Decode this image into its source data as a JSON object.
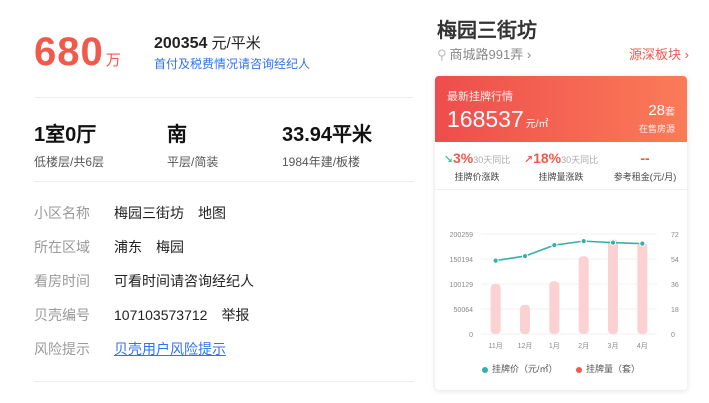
{
  "price": {
    "total": "680",
    "total_unit": "万",
    "unit_price": "200354",
    "unit_price_unit": " 元/平米",
    "tax_link": "首付及税费情况请咨询经纪人"
  },
  "house": {
    "layout": "1室0厅",
    "floor": "低楼层/共6层",
    "orientation": "南",
    "decoration": "平层/简装",
    "area": "33.94平米",
    "built": "1984年建/板楼"
  },
  "details": [
    {
      "label": "小区名称",
      "value": "梅园三街坊",
      "extra": "地图"
    },
    {
      "label": "所在区域",
      "value": "浦东",
      "extra": "梅园"
    },
    {
      "label": "看房时间",
      "value": "可看时间请咨询经纪人",
      "extra": ""
    },
    {
      "label": "贝壳编号",
      "value": "107103573712",
      "extra": "举报"
    },
    {
      "label": "风险提示",
      "value": "贝壳用户风险提示",
      "extra": ""
    }
  ],
  "community": {
    "name": "梅园三街坊",
    "address": "商城路991弄",
    "address_arrow": "›",
    "source_link": "源深板块 ›"
  },
  "market": {
    "label": "最新挂牌行情",
    "price": "168537",
    "price_unit": "元/㎡",
    "count": "28",
    "count_unit": "套",
    "count_label": "在售房源",
    "stats": [
      {
        "value": "3%",
        "compare": "30天同比",
        "label": "挂牌价涨跌",
        "trend": "down"
      },
      {
        "value": "18%",
        "compare": "30天同比",
        "label": "挂牌量涨跌",
        "trend": "up"
      },
      {
        "value": "--",
        "compare": "",
        "label": "参考租金(元/月)",
        "trend": ""
      }
    ]
  },
  "legend": {
    "price": "挂牌价（元/㎡）",
    "volume": "挂牌量（套）"
  },
  "colors": {
    "accent": "#f05a4b",
    "link": "#3072f6",
    "line": "#2fb3a6",
    "bar": "#fbd1d1"
  },
  "chart_data": {
    "type": "bar+line",
    "categories": [
      "11月",
      "12月",
      "1月",
      "2月",
      "3月",
      "4月"
    ],
    "left_axis_ticks": [
      "200259",
      "150194",
      "100129",
      "50064",
      "0"
    ],
    "right_axis_ticks": [
      "72",
      "54",
      "36",
      "18",
      "0"
    ],
    "ylim_left": [
      0,
      200259
    ],
    "ylim_right": [
      0,
      72
    ],
    "series": [
      {
        "name": "挂牌价（元/㎡）",
        "type": "line",
        "axis": "left",
        "values": [
          147000,
          156000,
          178000,
          186000,
          183000,
          181000
        ]
      },
      {
        "name": "挂牌量（套）",
        "type": "bar",
        "axis": "right",
        "values": [
          36,
          21,
          38,
          56,
          68,
          66
        ]
      }
    ]
  }
}
